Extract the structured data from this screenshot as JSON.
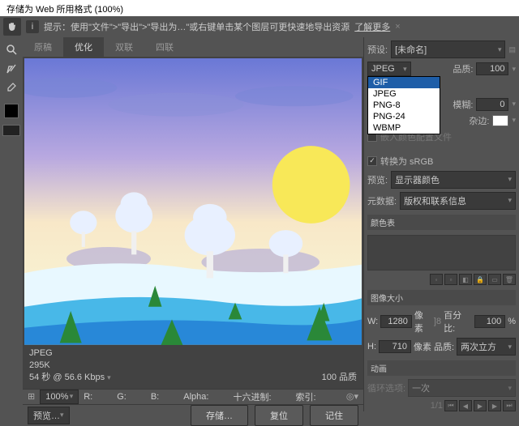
{
  "title": "存储为 Web 所用格式 (100%)",
  "hint": {
    "icon": "i",
    "text": "提示：使用\"文件\">\"导出\">\"导出为…\"或右键单击某个图层可更快速地导出资源",
    "more": "了解更多"
  },
  "tabs": {
    "original": "原稿",
    "optimized": "优化",
    "two_up": "双联",
    "four_up": "四联"
  },
  "status": {
    "format": "JPEG",
    "size": "295K",
    "time": "54 秒 @ 56.6 Kbps",
    "quality": "100 品质"
  },
  "zoom_bar": {
    "zoom": "100%",
    "r": "R:",
    "g": "G:",
    "b": "B:",
    "alpha": "Alpha:",
    "hex": "十六进制:",
    "index": "索引:",
    "preview": "预览…"
  },
  "right": {
    "preset_label": "预设:",
    "preset_value": "[未命名]",
    "format": "JPEG",
    "format_options": [
      "GIF",
      "JPEG",
      "PNG-8",
      "PNG-24",
      "WBMP"
    ],
    "quality_label": "品质:",
    "quality_value": "100",
    "blur_label": "模糊:",
    "blur_value": "0",
    "matte_label": "杂边:",
    "embed_profile": "嵌入颜色配置文件",
    "convert_srgb": "转换为 sRGB",
    "preview2_label": "预览:",
    "preview2_value": "显示器颜色",
    "metadata_label": "元数据:",
    "metadata_value": "版权和联系信息",
    "colortable_title": "颜色表",
    "imagesize_title": "图像大小",
    "w_label": "W:",
    "w_value": "1280",
    "h_label": "H:",
    "h_value": "710",
    "px": "像素",
    "percent_label": "百分比:",
    "percent_value": "100",
    "quality2_label": "品质:",
    "quality2_value": "两次立方",
    "anim_title": "动画",
    "loop_label": "循环选项:",
    "loop_value": "一次",
    "frame": "1/1"
  },
  "buttons": {
    "save": "存储…",
    "reset": "复位",
    "remember": "记住"
  }
}
